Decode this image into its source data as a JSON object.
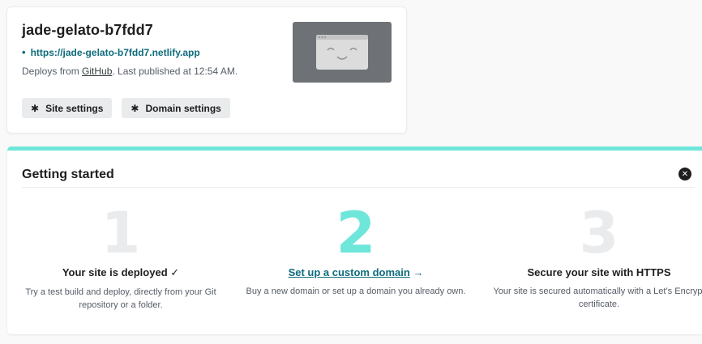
{
  "site": {
    "name": "jade-gelato-b7fdd7",
    "url": "https://jade-gelato-b7fdd7.netlify.app",
    "deploy_prefix": "Deploys from ",
    "deploy_source": "GitHub",
    "deploy_suffix": ". Last published at 12:54 AM.",
    "buttons": {
      "site_settings": "Site settings",
      "domain_settings": "Domain settings"
    },
    "thumbnail_icon": "smiley-browser-icon"
  },
  "getting_started": {
    "title": "Getting started",
    "close_icon": "close-icon",
    "steps": [
      {
        "number": "1",
        "title": "Your site is deployed ✓",
        "description": "Try a test build and deploy, directly from your Git repository or a folder.",
        "state": "done"
      },
      {
        "number": "2",
        "title": "Set up a custom domain",
        "title_arrow": "→",
        "description": "Buy a new domain or set up a domain you already own.",
        "state": "current"
      },
      {
        "number": "3",
        "title": "Secure your site with HTTPS",
        "description": "Your site is secured automatically with a Let’s Encrypt certificate.",
        "state": "todo"
      }
    ]
  },
  "colors": {
    "accent_teal": "#6fe6da",
    "link_teal": "#0e6c7c",
    "button_bg": "#e9ebed",
    "thumbnail_bg": "#6e7176"
  }
}
